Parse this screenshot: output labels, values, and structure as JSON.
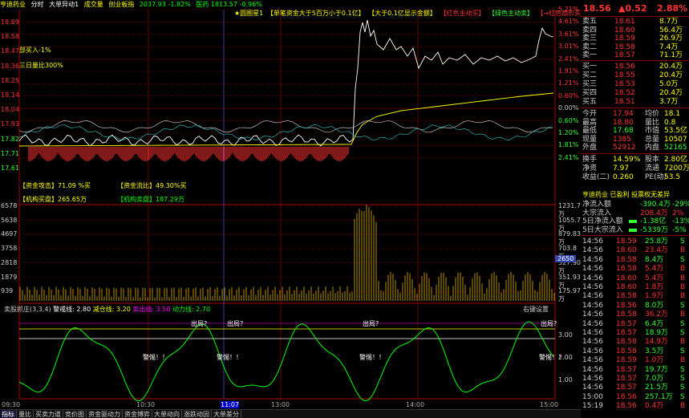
{
  "title_bar": {
    "stock": "亨迪药业",
    "view": "分时",
    "indicator": "大单异动1",
    "vol_label": "成交量",
    "index_name": "创业板指",
    "index_value": "2037.93 -1.82%",
    "sector": "医药 1813.57 -0.96%"
  },
  "legend_top": [
    "★圆圈星1",
    "【单笔资金大于5百万小于0.1亿】",
    "【大于0.1亿显示金额】",
    "【红色主动买】",
    "【绿色主动卖】",
    "【→红色扇形买】"
  ],
  "overlay_labels": {
    "buy": "部买入-1%",
    "ratio": "三日量比300%"
  },
  "price_axis_left": [
    "18.69",
    "18.58",
    "18.47",
    "18.36",
    "18.25",
    "18.14",
    "18.04",
    "17.93",
    "17.82",
    "17.71",
    "17.61"
  ],
  "price_axis_right": [
    "5.21%",
    "4.61%",
    "3.61%",
    "3.01%",
    "2.41%",
    "1.91%",
    "1.21%",
    "0.60%",
    "0.00%",
    "0.60%",
    "1.20%",
    "1.81%",
    "2.41%"
  ],
  "fund_box": {
    "attack": "【资金攻击】71.09 %买",
    "flow": "【资金流比】49.30%买",
    "inst": "【机构买盘】265.65万",
    "inst2": "【机构卖盘】187.29万"
  },
  "vol_axis_left": [
    "6578",
    "5638",
    "4697",
    "3758",
    "2818",
    "1879",
    "939"
  ],
  "vol_axis_right": [
    "1231.75万",
    "1055.79万",
    "879.83万",
    "703.8万",
    "527.90万",
    "351.93万",
    "175.97万"
  ],
  "vol_cursor_value": "2650",
  "indicator_panel": {
    "name": "卖股抓庄(3,3,4)",
    "warn": "警戒线: 2.80",
    "reduce": "减仓线: 3.20",
    "sell": "卖出线: 3.50",
    "power": "动力线: 2.70",
    "settings": "右键设置",
    "axis": [
      "3.00",
      "2.00",
      "1.00"
    ],
    "tags_run": "出局?",
    "tags_warn": "警惕！！"
  },
  "time_axis": [
    "09:30",
    "10:30",
    "11:07",
    "13:00",
    "14:00",
    "15:00"
  ],
  "tabs": [
    "指标",
    "量比",
    "买卖力道",
    "竞价图",
    "资金驱动力",
    "资金博弈",
    "大单动向",
    "涨跌动因",
    "大单差分"
  ],
  "quote_header": {
    "price": "18.56",
    "change": "▲0.52",
    "pct": "2.88%"
  },
  "sell_orders": [
    {
      "label": "卖五",
      "price": "18.61",
      "vol": "8.7万"
    },
    {
      "label": "卖四",
      "price": "18.60",
      "vol": "56.4万"
    },
    {
      "label": "卖三",
      "price": "18.59",
      "vol": "26.9万"
    },
    {
      "label": "卖二",
      "price": "18.58",
      "vol": "7.4万"
    },
    {
      "label": "卖一",
      "price": "18.57",
      "vol": "71.1万"
    }
  ],
  "buy_orders": [
    {
      "label": "买一",
      "price": "18.56",
      "vol": "20.4万"
    },
    {
      "label": "买二",
      "price": "18.55",
      "vol": "20.4万"
    },
    {
      "label": "买三",
      "price": "18.53",
      "vol": "5.0万"
    },
    {
      "label": "买四",
      "price": "18.52",
      "vol": "20.4万"
    },
    {
      "label": "买五",
      "price": "18.51",
      "vol": "3.7万"
    }
  ],
  "stats": [
    {
      "k1": "今开",
      "v1": "17.94",
      "k2": "均价",
      "v2": "18.1"
    },
    {
      "k1": "最高",
      "v1": "18.80",
      "k2": "量比",
      "v2": "0.8"
    },
    {
      "k1": "最低",
      "v1": "17.68",
      "k2": "市值",
      "v2": "53.5亿"
    },
    {
      "k1": "现量",
      "v1": "1385",
      "k2": "总量",
      "v2": "10507"
    },
    {
      "k1": "外盘",
      "v1": "52912",
      "k2": "内盘",
      "v2": "52165"
    }
  ],
  "stats2": [
    {
      "k1": "换手",
      "v1": "14.59%",
      "k2": "股本",
      "v2": "2.80亿"
    },
    {
      "k1": "净资",
      "v1": "7.97",
      "k2": "流通",
      "v2": "7200万"
    },
    {
      "k1": "收益(二)",
      "v1": "0.260",
      "k2": "PE(动)",
      "v2": "53.5"
    }
  ],
  "info_line": "亨迪药业 已盈利 投票权无差异",
  "flows": [
    {
      "k": "净流入额",
      "v": "-390.4万",
      "p": "-29%"
    },
    {
      "k": "大宗流入",
      "v": "208.4万",
      "p": "2%"
    },
    {
      "k": "5日净流入额",
      "v": "-1.38亿",
      "p": "-13%"
    },
    {
      "k": "5日大宗流入",
      "v": "-5339万",
      "p": "-5%"
    }
  ],
  "ticks": [
    {
      "t": "14:56",
      "p": "18.59",
      "v": "25.8万",
      "d": "S"
    },
    {
      "t": "14:56",
      "p": "18.60",
      "v": "23.4万",
      "d": "B"
    },
    {
      "t": "14:56",
      "p": "18.58",
      "v": "8.4万",
      "d": "S"
    },
    {
      "t": "14:56",
      "p": "18.58",
      "v": "5.4万",
      "d": "B"
    },
    {
      "t": "14:56",
      "p": "18.60",
      "v": "5.4万",
      "d": "B"
    },
    {
      "t": "14:56",
      "p": "18.60",
      "v": "1.8万",
      "d": "B"
    },
    {
      "t": "14:56",
      "p": "18.58",
      "v": "1.9万",
      "d": "B"
    },
    {
      "t": "14:56",
      "p": "18.56",
      "v": "8.0万",
      "d": "S"
    },
    {
      "t": "14:56",
      "p": "18.58",
      "v": "36.2万",
      "d": "B"
    },
    {
      "t": "14:56",
      "p": "18.57",
      "v": "6.4万",
      "d": "S"
    },
    {
      "t": "14:56",
      "p": "18.57",
      "v": "18.9万",
      "d": "S"
    },
    {
      "t": "14:56",
      "p": "18.58",
      "v": "14.9万",
      "d": "B"
    },
    {
      "t": "14:56",
      "p": "18.58",
      "v": "3.5万",
      "d": "S"
    },
    {
      "t": "14:56",
      "p": "18.59",
      "v": "1.0万",
      "d": "B"
    },
    {
      "t": "14:56",
      "p": "18.57",
      "v": "19.7万",
      "d": "S"
    },
    {
      "t": "14:56",
      "p": "18.57",
      "v": "7.0万",
      "d": "S"
    },
    {
      "t": "14:56",
      "p": "18.57",
      "v": "21.5万",
      "d": "S"
    },
    {
      "t": "15:00",
      "p": "18.56",
      "v": "257.1万",
      "d": "S"
    },
    {
      "t": "15:19",
      "p": "18.56",
      "v": "0.4万",
      "d": "B"
    }
  ],
  "colors": {
    "up": "#ff3333",
    "down": "#33ff33",
    "price_line": "#ffffff",
    "avg_line": "#ffff00",
    "grid": "#800000",
    "volume": "#b09000",
    "indicator": "#00ff00"
  }
}
